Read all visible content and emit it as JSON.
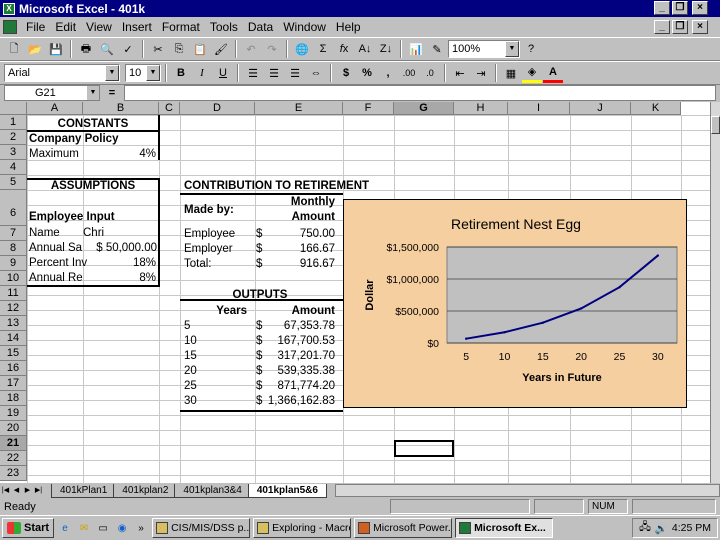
{
  "window": {
    "title": "Microsoft Excel - 401k",
    "buttons": {
      "minimize": "_",
      "restore": "❐",
      "close": "×"
    }
  },
  "menu": [
    "File",
    "Edit",
    "View",
    "Insert",
    "Format",
    "Tools",
    "Data",
    "Window",
    "Help"
  ],
  "standard_toolbar": {
    "zoom": "100%"
  },
  "format_toolbar": {
    "font": "Arial",
    "size": "10",
    "bold": "B",
    "italic": "I",
    "underline": "U",
    "currency": "$",
    "percent": "%",
    "comma": ",",
    "inc_decimal": ".00",
    "dec_decimal": ".0"
  },
  "formula_bar": {
    "name_box": "G21",
    "equals": "=",
    "content": ""
  },
  "columns": [
    "A",
    "B",
    "C",
    "D",
    "E",
    "F",
    "G",
    "H",
    "I",
    "J",
    "K"
  ],
  "rows": [
    "1",
    "2",
    "3",
    "4",
    "5",
    "6",
    "7",
    "8",
    "9",
    "10",
    "11",
    "12",
    "13",
    "14",
    "15",
    "16",
    "17",
    "18",
    "19",
    "20",
    "21",
    "22",
    "23"
  ],
  "sheet": {
    "constants_header": "CONSTANTS",
    "company_policy": "Company Policy",
    "maximum_label": "Maximum",
    "maximum_value": "4%",
    "assumptions_header": "ASSUMPTIONS",
    "employee_input": "Employee Input",
    "name_label": "Name",
    "name_value": "Chri",
    "annual_salary_label": "Annual Sa",
    "annual_salary_value": "$ 50,000.00",
    "percent_label": "Percent Inv",
    "percent_value": "18%",
    "annual_return_label": "Annual Re",
    "annual_return_value": "8%",
    "contribution_header": "CONTRIBUTION TO RETIREMENT",
    "made_by": "Made by:",
    "monthly_1": "Monthly",
    "monthly_2": "Amount",
    "contrib_rows": [
      {
        "label": "Employee",
        "cur": "$",
        "amount": "750.00"
      },
      {
        "label": "Employer",
        "cur": "$",
        "amount": "166.67"
      },
      {
        "label": "Total:",
        "cur": "$",
        "amount": "916.67"
      }
    ],
    "outputs_header": "OUTPUTS",
    "years_header": "Years",
    "amount_header": "Amount",
    "output_rows": [
      {
        "years": "5",
        "cur": "$",
        "amount": "67,353.78"
      },
      {
        "years": "10",
        "cur": "$",
        "amount": "167,700.53"
      },
      {
        "years": "15",
        "cur": "$",
        "amount": "317,201.70"
      },
      {
        "years": "20",
        "cur": "$",
        "amount": "539,335.38"
      },
      {
        "years": "25",
        "cur": "$",
        "amount": "871,774.20"
      },
      {
        "years": "30",
        "cur": "$",
        "amount": "1,366,162.83"
      }
    ]
  },
  "chart_data": {
    "type": "line",
    "title": "Retirement Nest Egg",
    "xlabel": "Years in Future",
    "ylabel": "Dollar",
    "categories": [
      "5",
      "10",
      "15",
      "20",
      "25",
      "30"
    ],
    "values": [
      67353.78,
      167700.53,
      317201.7,
      539335.38,
      871774.2,
      1366162.83
    ],
    "ylim": [
      0,
      1500000
    ],
    "yticks": [
      "$0",
      "$500,000",
      "$1,000,000",
      "$1,500,000"
    ],
    "ytick_values": [
      0,
      500000,
      1000000,
      1500000
    ],
    "grid": true,
    "line_color": "#000080",
    "plot_bg": "#c0c0c0",
    "chart_bg": "#f6cfa0"
  },
  "sheet_tabs": [
    {
      "label": "401kPlan1",
      "active": false
    },
    {
      "label": "401kplan2",
      "active": false
    },
    {
      "label": "401kplan3&4",
      "active": false
    },
    {
      "label": "401kplan5&6",
      "active": true
    }
  ],
  "status": {
    "ready": "Ready",
    "num": "NUM"
  },
  "taskbar": {
    "start": "Start",
    "chevron": "»",
    "buttons": [
      {
        "label": "CIS/MIS/DSS p...",
        "active": false,
        "color": "#d8c060"
      },
      {
        "label": "Exploring - Macro",
        "active": false,
        "color": "#d8c060"
      },
      {
        "label": "Microsoft Power...",
        "active": false,
        "color": "#d06020"
      },
      {
        "label": "Microsoft Ex...",
        "active": true,
        "color": "#1f7a3a"
      }
    ],
    "clock": "4:25 PM"
  }
}
